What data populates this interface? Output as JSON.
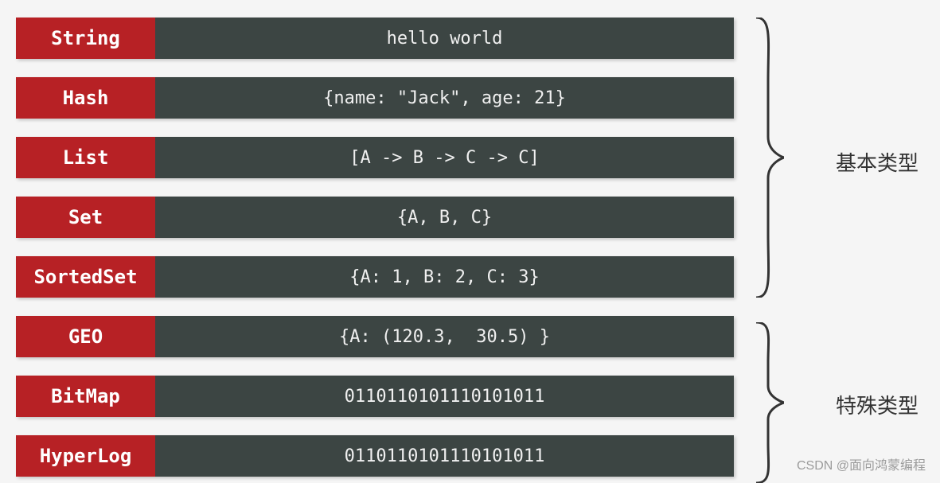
{
  "rows": [
    {
      "type": "String",
      "value": "hello world"
    },
    {
      "type": "Hash",
      "value": "{name: \"Jack\", age: 21}"
    },
    {
      "type": "List",
      "value": "[A -> B -> C -> C]"
    },
    {
      "type": "Set",
      "value": "{A, B, C}"
    },
    {
      "type": "SortedSet",
      "value": "{A: 1, B: 2, C: 3}"
    },
    {
      "type": "GEO",
      "value": "{A: (120.3,  30.5) }"
    },
    {
      "type": "BitMap",
      "value": "0110110101110101011"
    },
    {
      "type": "HyperLog",
      "value": "0110110101110101011"
    }
  ],
  "groups": {
    "basic": "基本类型",
    "special": "特殊类型"
  },
  "watermark": "CSDN @面向鸿蒙编程"
}
